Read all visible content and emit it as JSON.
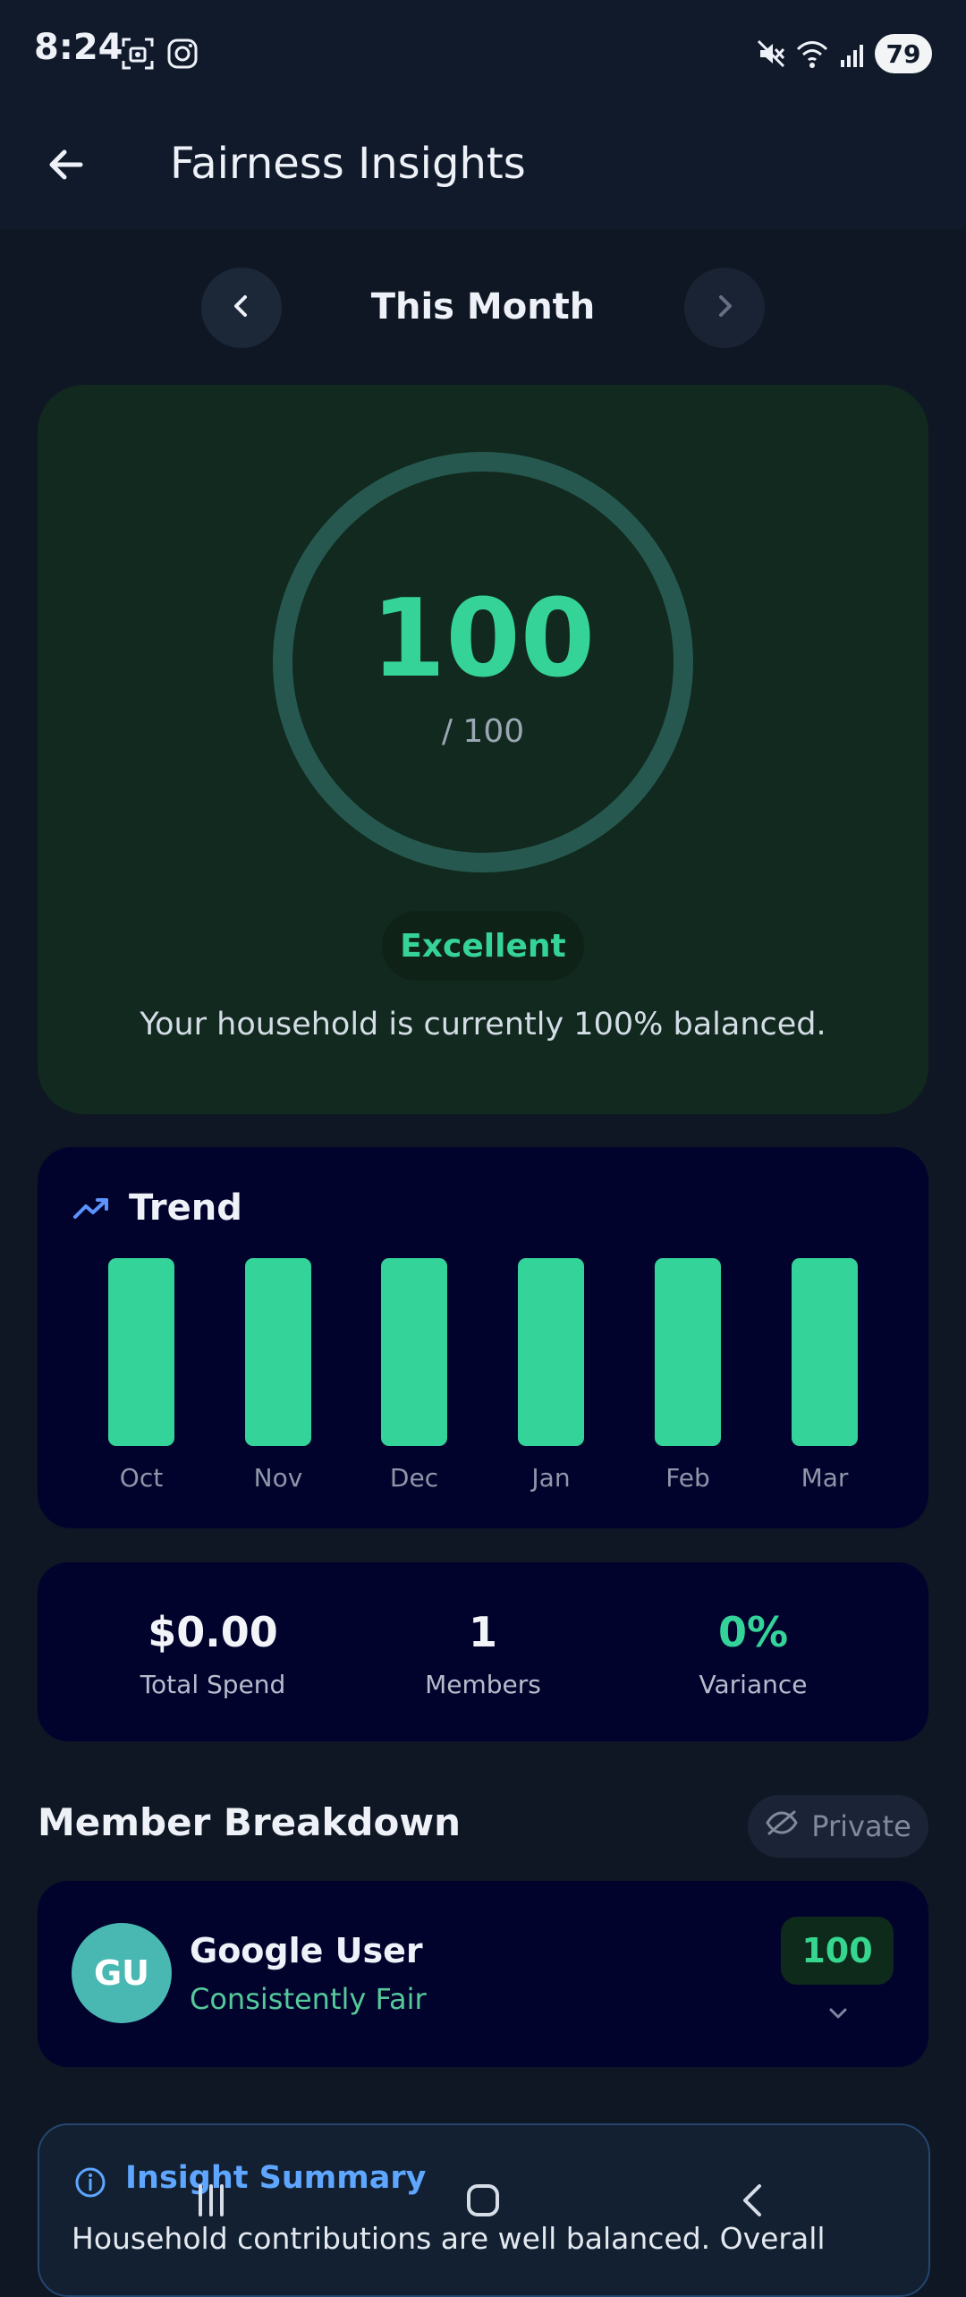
{
  "status_bar": {
    "time": "8:24",
    "battery": "79"
  },
  "header": {
    "title": "Fairness Insights"
  },
  "period": {
    "label": "This Month"
  },
  "score": {
    "value": "100",
    "max": "/ 100",
    "level": 1.0,
    "rating": "Excellent",
    "description": "Your household is currently 100% balanced."
  },
  "trend": {
    "title": "Trend",
    "months": [
      "Oct",
      "Nov",
      "Dec",
      "Jan",
      "Feb",
      "Mar"
    ]
  },
  "stats": [
    {
      "value": "$0.00",
      "label": "Total Spend",
      "color": "#f2f4f8"
    },
    {
      "value": "1",
      "label": "Members",
      "color": "#f2f4f8"
    },
    {
      "value": "0%",
      "label": "Variance",
      "color": "#34d399"
    }
  ],
  "breakdown": {
    "title": "Member Breakdown",
    "privacy_label": "Private",
    "members": [
      {
        "initials": "GU",
        "name": "Google User",
        "status": "Consistently Fair",
        "score": "100"
      }
    ]
  },
  "insight": {
    "title": "Insight Summary",
    "text": "Household contributions are well balanced. Overall"
  },
  "colors": {
    "background": "#0f1724",
    "accent_green": "#34d399",
    "score_card": "#11291e",
    "card_navy": "#02032d",
    "insight_blue": "#5ea6ff"
  },
  "icons": {
    "back": "arrow-left-icon",
    "previous": "chevron-left-icon",
    "next": "chevron-right-icon",
    "trend": "trending-up-icon",
    "private": "eye-off-icon",
    "expand": "chevron-down-icon",
    "info": "info-icon"
  }
}
